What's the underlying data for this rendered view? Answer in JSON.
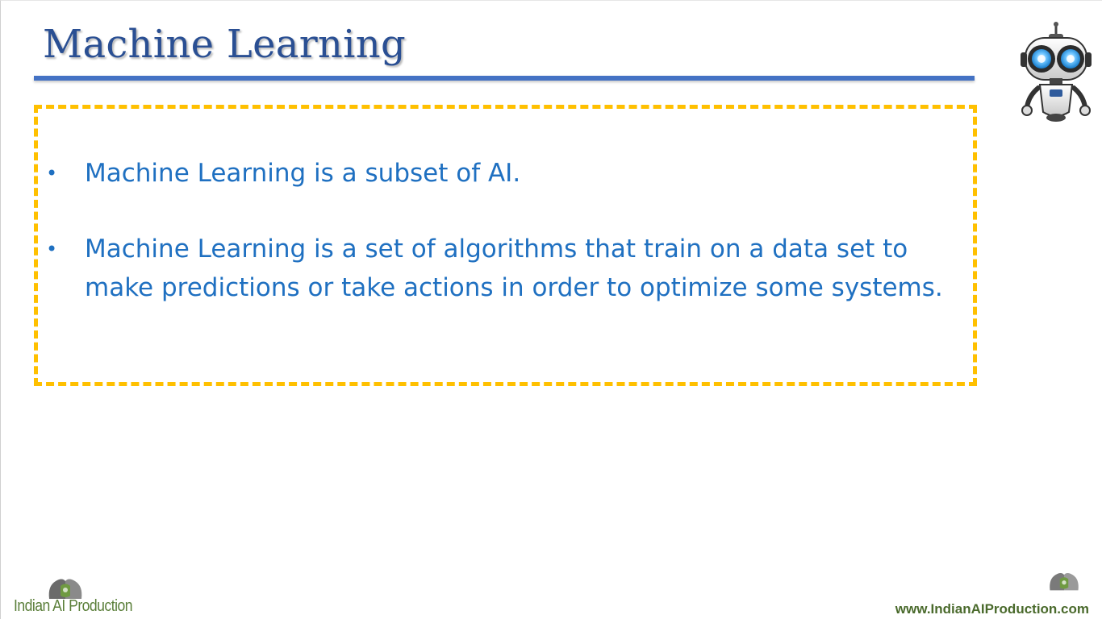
{
  "slide": {
    "title": "Machine Learning",
    "bullets": [
      {
        "marker": "•",
        "text": "Machine Learning is a subset of AI."
      },
      {
        "marker": "•",
        "text": "Machine Learning is a set of algorithms that train on a data set to make predictions or take actions in order to optimize some systems."
      }
    ]
  },
  "footer": {
    "brand_name": "Indian AI Production",
    "website": "www.IndianAIProduction.com"
  },
  "colors": {
    "title": "#2a4f93",
    "title_rule": "#4472c4",
    "box_border": "#ffc000",
    "bullet_text": "#1f70c1",
    "brand_green": "#5b7f3a"
  },
  "icons": {
    "robot": "robot-mascot-icon",
    "logo": "two-heads-logo-icon"
  }
}
